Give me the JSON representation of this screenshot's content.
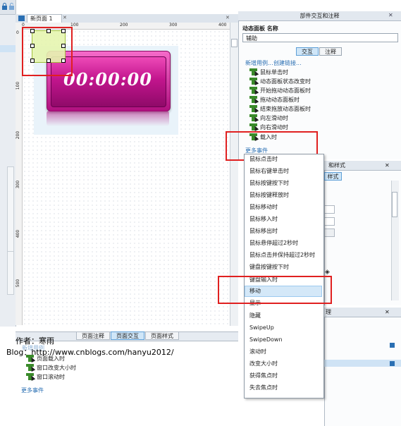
{
  "canvas": {
    "tab_label": "新页面 1",
    "ruler_top": [
      "0",
      "100",
      "200",
      "300",
      "400"
    ],
    "ruler_left": [
      "0",
      "100",
      "200",
      "300",
      "400",
      "500"
    ],
    "clock_text": "00:00:00"
  },
  "bottom_panel": {
    "tabs": [
      "页面注释",
      "页面交互",
      "页面样式"
    ],
    "active_tab": "页面交互",
    "author": "作者：寒雨",
    "blog": "Blog：http://www.cnblogs.com/hanyu2012/",
    "events": [
      "页面载入时",
      "窗口改变大小时",
      "窗口滚动时"
    ],
    "more_events": "更多事件",
    "faded_link": "新增用例"
  },
  "interaction_panel": {
    "title": "部件交互和注释",
    "name_label": "动态面板 名称",
    "name_value": "辅助",
    "tabs": [
      "交互",
      "注释"
    ],
    "active_tab": "交互",
    "new_case_link": "新增用例...",
    "create_link": "创建链接...",
    "events": [
      "鼠标单击时",
      "动态面板状态改变时",
      "开始拖动动态面板时",
      "拖动动态面板时",
      "结束拖放动态面板时",
      "向左滑动时",
      "向右滑动时",
      "载入时"
    ],
    "more_events": "更多事件"
  },
  "style_panel": {
    "title_partial": "和样式",
    "tab": "样式"
  },
  "bottom_right_panel": {
    "title_partial": "理"
  },
  "dropdown_menu": {
    "items": [
      "鼠标点击时",
      "鼠标右键单击时",
      "鼠标按键按下时",
      "鼠标按键释放时",
      "鼠标移动时",
      "鼠标移入时",
      "鼠标移出时",
      "鼠标悬停超过2秒时",
      "鼠标点击并保持超过2秒时",
      "键盘按键按下时",
      "键盘输入时",
      "移动",
      "显示",
      "隐藏",
      "SwipeUp",
      "SwipeDown",
      "滚动时",
      "改变大小时",
      "获得焦点时",
      "失去焦点时"
    ],
    "highlighted": "移动"
  },
  "colors": {
    "accent": "#2a6fb3",
    "highlight_box": "#e02020",
    "clock_magenta": "#c2158d",
    "menu_highlight": "#d4e8f8"
  }
}
